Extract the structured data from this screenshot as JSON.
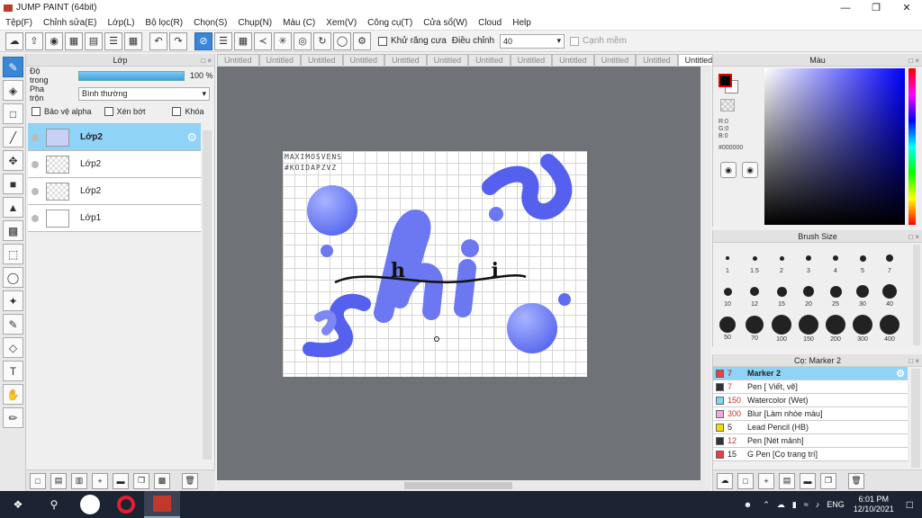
{
  "window": {
    "title": "JUMP PAINT (64bit)",
    "min_icon": "minimize-icon",
    "max_icon": "maximize-icon",
    "close_icon": "close-icon"
  },
  "menu": [
    "Tệp(F)",
    "Chỉnh sửa(E)",
    "Lớp(L)",
    "Bộ lọc(R)",
    "Chọn(S)",
    "Chụp(N)",
    "Màu (C)",
    "Xem(V)",
    "Công cụ(T)",
    "Cửa sổ(W)",
    "Cloud",
    "Help"
  ],
  "toolbar": {
    "antialias_label": "Khử răng cưa",
    "adjust_label": "Điều chỉnh",
    "adjust_value": "40",
    "smooth_label": "Cạnh mềm"
  },
  "layers_panel": {
    "title": "Lớp",
    "opacity_label": "Độ trong",
    "opacity_value": "100 %",
    "opacity_percent": 100,
    "blend_label": "Pha trộn",
    "blend_value": "Bình thường",
    "protect_alpha": "Bảo vệ alpha",
    "clip": "Xén bớt",
    "lock": "Khóa",
    "layers": [
      {
        "name": "Lớp2",
        "selected": true
      },
      {
        "name": "Lớp2",
        "selected": false
      },
      {
        "name": "Lớp2",
        "selected": false
      },
      {
        "name": "Lớp1",
        "selected": false
      }
    ]
  },
  "canvas": {
    "tabs": [
      "Untitled",
      "Untitled",
      "Untitled",
      "Untitled",
      "Untitled",
      "Untitled",
      "Untitled",
      "Untitled",
      "Untitled",
      "Untitled",
      "Untitled",
      "Untitled"
    ],
    "active_tab": 11,
    "watermark_1": "MAXIMOSVENS",
    "watermark_2": "#KOIDAPZVZ",
    "art_text": "hi",
    "art_ink": "h  i"
  },
  "color_panel": {
    "title": "Màu",
    "r": "R:0",
    "g": "G:0",
    "b": "B:0",
    "hex": "#000000",
    "fg_color": "#000000",
    "bg_color": "#ffffff"
  },
  "brush_size_panel": {
    "title": "Brush Size",
    "sizes": [
      "1",
      "1.5",
      "2",
      "3",
      "4",
      "5",
      "7",
      "10",
      "12",
      "15",
      "20",
      "25",
      "30",
      "40",
      "50",
      "70",
      "100",
      "150",
      "200",
      "300",
      "400"
    ]
  },
  "preset_panel": {
    "title": "Cọ: Marker 2",
    "presets": [
      {
        "num": "7",
        "name": "Marker 2",
        "color": "#e84040",
        "selected": true
      },
      {
        "num": "7",
        "name": "Pen [ Viết, vẽ]",
        "color": "#333333",
        "selected": false
      },
      {
        "num": "150",
        "name": "Watercolor (Wet)",
        "color": "#7fd6f0",
        "selected": false
      },
      {
        "num": "300",
        "name": "Blur [Làm nhòe màu]",
        "color": "#f3a6e0",
        "selected": false
      },
      {
        "num": "5",
        "name": "Lead Pencil (HB)",
        "color": "#f0e000",
        "selected": false
      },
      {
        "num": "12",
        "name": "Pen [Nét mảnh]",
        "color": "#333333",
        "selected": false
      },
      {
        "num": "15",
        "name": "G Pen [Cọ trang trí]",
        "color": "#e84040",
        "selected": false
      }
    ]
  },
  "taskbar": {
    "lang": "ENG",
    "time": "6:01 PM",
    "date": "12/10/2021"
  }
}
